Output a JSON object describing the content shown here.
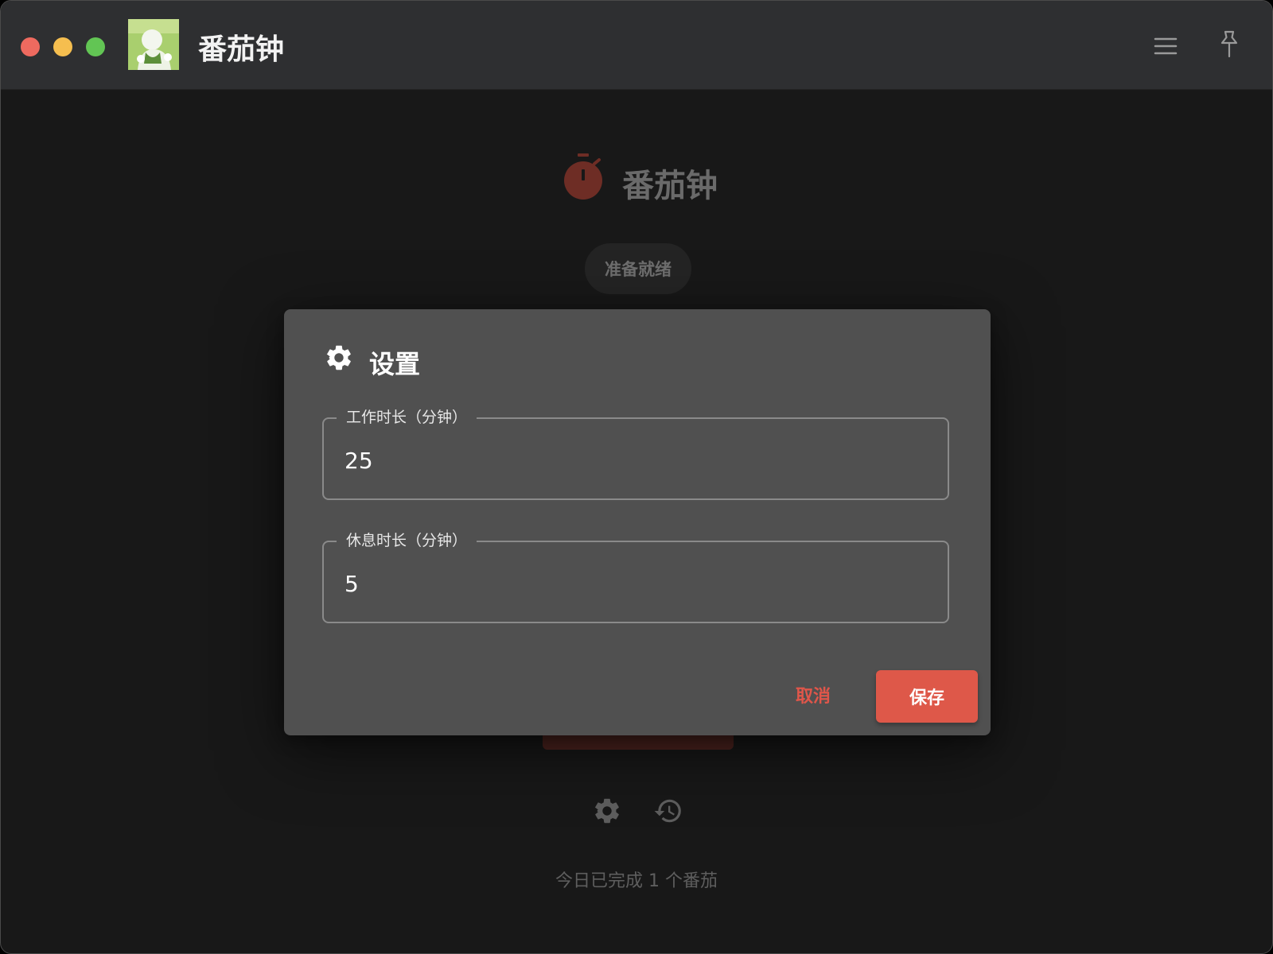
{
  "window": {
    "title": "番茄钟",
    "controls": {
      "close": "close-button",
      "minimize": "minimize-button",
      "zoom": "zoom-button"
    },
    "menu_icon": "menu-icon",
    "pin_icon": "pin-icon"
  },
  "main": {
    "title": "番茄钟",
    "status": "准备就绪",
    "today_summary": "今日已完成 1 个番茄",
    "accent_color": "#de5849"
  },
  "dialog": {
    "title": "设置",
    "fields": [
      {
        "label": "工作时长（分钟）",
        "value": "25"
      },
      {
        "label": "休息时长（分钟）",
        "value": "5"
      }
    ],
    "cancel_label": "取消",
    "save_label": "保存"
  }
}
